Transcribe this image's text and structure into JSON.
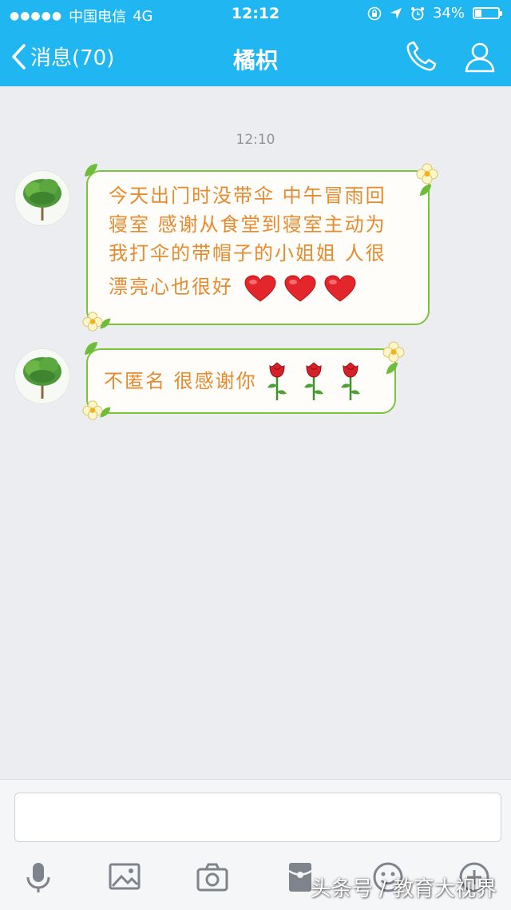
{
  "status_bar": {
    "carrier": "中国电信",
    "network": "4G",
    "time": "12:12",
    "battery": "34%",
    "battery_level": 0.34
  },
  "nav": {
    "back_label": "消息(70)",
    "title": "橘枳"
  },
  "chat": {
    "timestamp": "12:10",
    "messages": [
      {
        "lines": [
          "今天出门时没带伞 中午冒雨回",
          "寝室 感谢从食堂到寝室主动为",
          "我打伞的带帽子的小姐姐  人很",
          "漂亮心也很好"
        ],
        "emoji": [
          "heart",
          "heart",
          "heart"
        ]
      },
      {
        "lines": [
          "不匿名 很感谢你"
        ],
        "emoji": [
          "rose",
          "rose",
          "rose"
        ]
      }
    ]
  },
  "composer": {
    "input_value": "",
    "tools": [
      "microphone-icon",
      "image-icon",
      "camera-icon",
      "red-packet-icon",
      "emoji-icon",
      "plus-icon"
    ]
  },
  "watermark": "头条号 / 教育大视界",
  "colors": {
    "header": "#1fb6f1",
    "background": "#ebedf1",
    "bubble_border": "#7cc33a",
    "bubble_text": "#e58a2f"
  }
}
